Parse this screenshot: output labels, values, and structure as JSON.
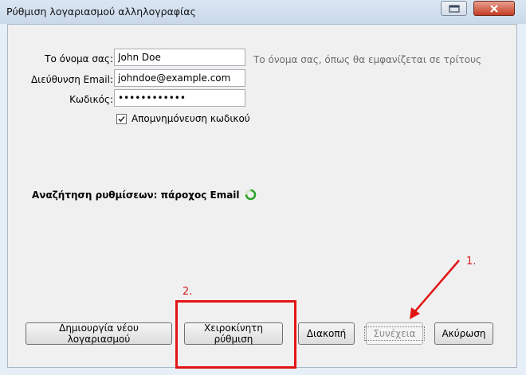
{
  "window": {
    "title": "Ρύθμιση λογαριασμού αλληλογραφίας"
  },
  "form": {
    "name_label": "Το όνομα σας:",
    "name_value": "John Doe",
    "name_hint": "Το όνομα σας, όπως θα εμφανίζεται σε τρίτους",
    "email_label": "Διεύθυνση Email:",
    "email_value": "johndoe@example.com",
    "password_label": "Κωδικός:",
    "password_value": "password1234",
    "remember_label": "Απομνημόνευση κωδικού",
    "remember_checked": true
  },
  "status": {
    "search_text": "Αναζήτηση ρυθμίσεων: πάροχος Email"
  },
  "buttons": {
    "create_new": "Δημιουργία νέου λογαριασμού",
    "manual": "Χειροκίνητη ρύθμιση",
    "stop": "Διακοπή",
    "continue": "Συνέχεια",
    "cancel": "Ακύρωση"
  },
  "annotations": {
    "step1": "1.",
    "step2": "2.",
    "color": "#e31414"
  },
  "icons": {
    "spinner": "loading-spinner-icon",
    "close": "close-icon",
    "restore": "restore-icon"
  }
}
